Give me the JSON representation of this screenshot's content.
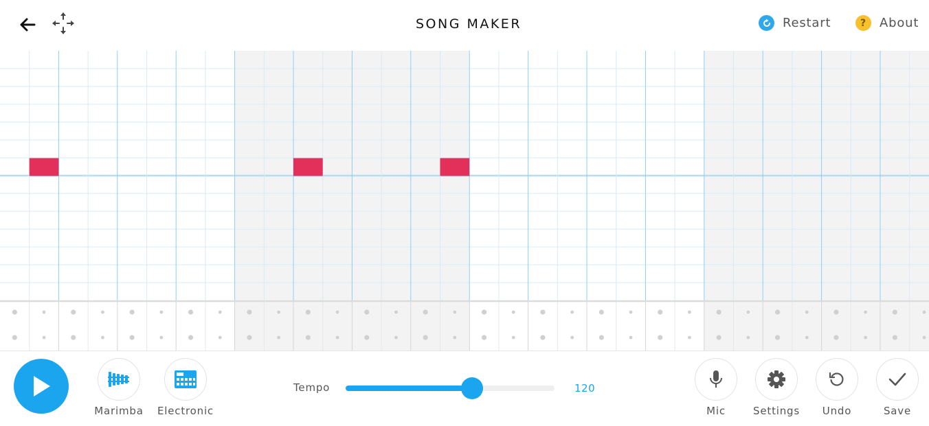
{
  "header": {
    "title": "SONG MAKER",
    "back_icon": "arrow-left-icon",
    "move_icon": "move-arrows-icon",
    "restart_label": "Restart",
    "about_label": "About",
    "restart_color": "#2ea8ea",
    "about_color": "#f8c02d"
  },
  "grid": {
    "melody_rows": 14,
    "columns": 32,
    "beats_per_bar": 8,
    "octave_line_after_row": 7,
    "percussion_rows": 2,
    "note_color": "#e3305a",
    "notes": [
      {
        "col": 1,
        "row": 6
      },
      {
        "col": 10,
        "row": 6
      },
      {
        "col": 15,
        "row": 6
      }
    ]
  },
  "bottom": {
    "play_icon": "play-icon",
    "marimba_label": "Marimba",
    "electronic_label": "Electronic",
    "tempo_label": "Tempo",
    "tempo_value": "120",
    "tempo_fraction": 0.605,
    "mic_label": "Mic",
    "settings_label": "Settings",
    "undo_label": "Undo",
    "save_label": "Save",
    "accent_color": "#1aa5ee"
  }
}
